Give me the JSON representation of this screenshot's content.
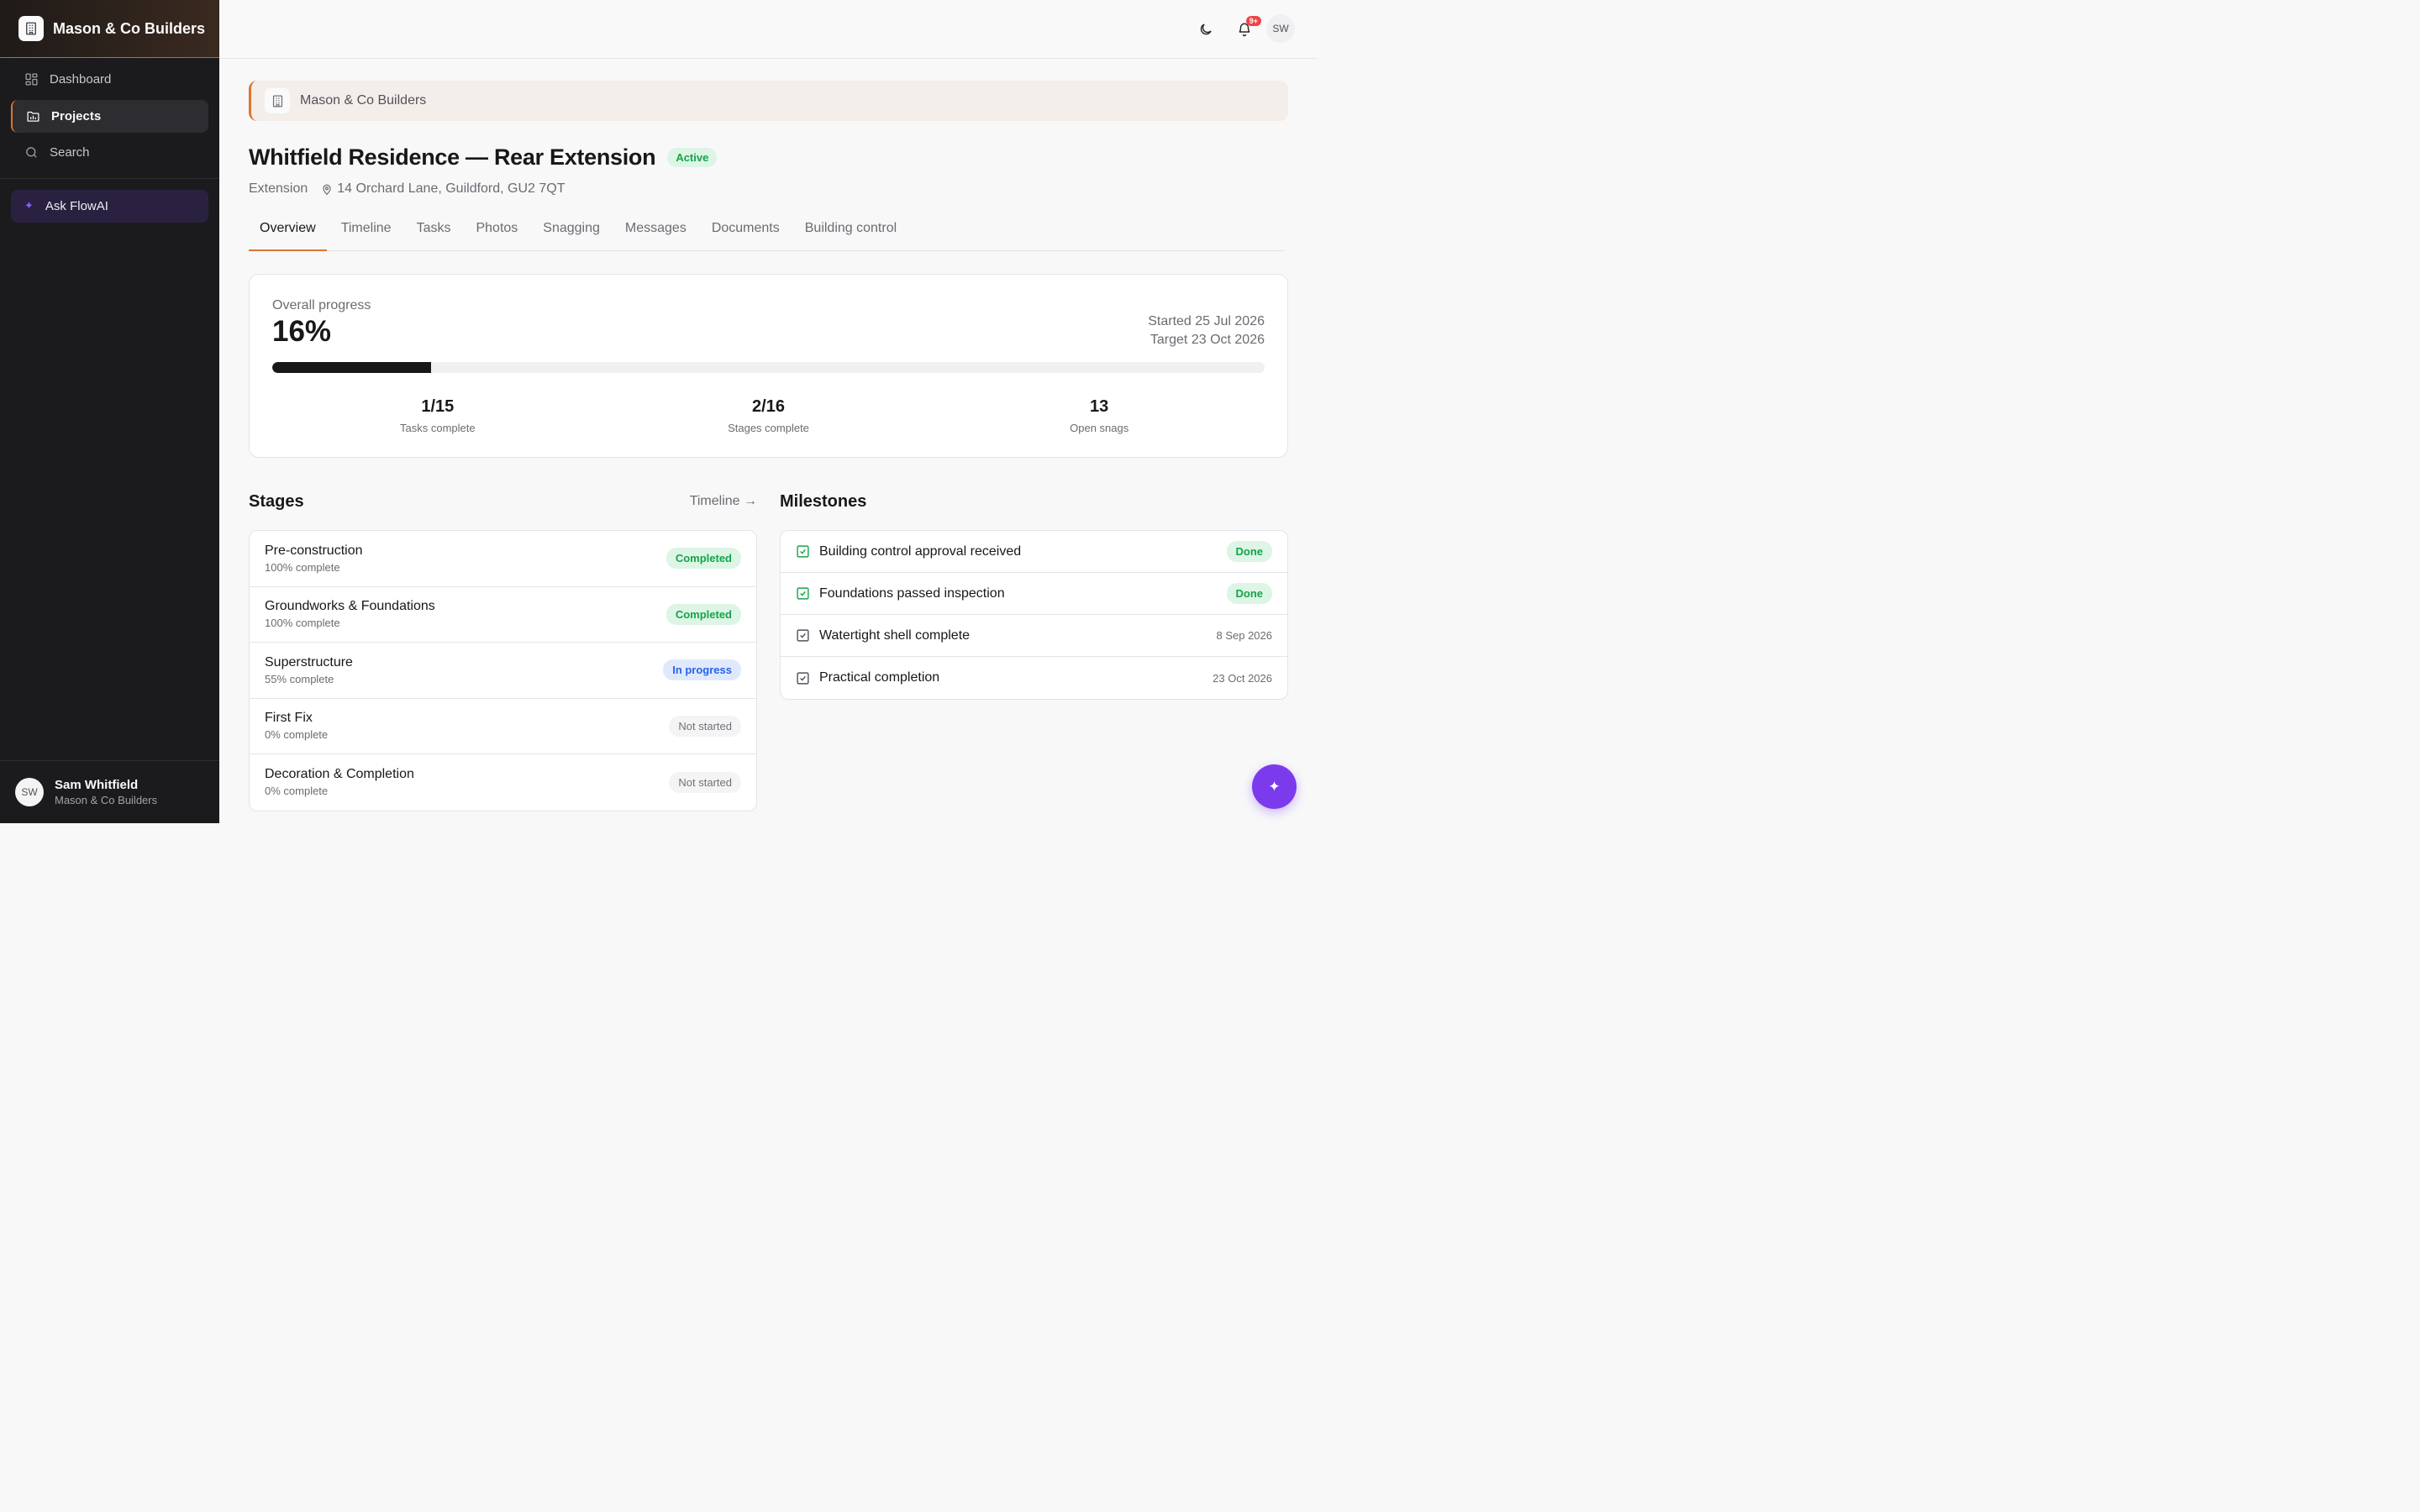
{
  "sidebar": {
    "brand": "Mason & Co Builders",
    "nav": [
      {
        "label": "Dashboard",
        "icon": "dashboard-icon"
      },
      {
        "label": "Projects",
        "icon": "folder-chart-icon",
        "active": true
      },
      {
        "label": "Search",
        "icon": "search-icon"
      }
    ],
    "ask": "Ask FlowAI",
    "user": {
      "initials": "SW",
      "name": "Sam Whitfield",
      "org": "Mason & Co Builders"
    }
  },
  "topbar": {
    "notif_badge": "9+",
    "avatar": "SW"
  },
  "org_banner": "Mason & Co Builders",
  "project": {
    "title": "Whitfield Residence — Rear Extension",
    "status": "Active",
    "type": "Extension",
    "address": "14 Orchard Lane, Guildford, GU2 7QT"
  },
  "tabs": [
    "Overview",
    "Timeline",
    "Tasks",
    "Photos",
    "Snagging",
    "Messages",
    "Documents",
    "Building control"
  ],
  "progress": {
    "label": "Overall progress",
    "value": "16%",
    "fraction": 0.16,
    "started": "Started 25 Jul 2026",
    "target": "Target 23 Oct 2026",
    "stats": [
      {
        "value": "1/15",
        "label": "Tasks complete"
      },
      {
        "value": "2/16",
        "label": "Stages complete"
      },
      {
        "value": "13",
        "label": "Open snags"
      }
    ]
  },
  "stages": {
    "title": "Stages",
    "link": "Timeline →",
    "items": [
      {
        "name": "Pre-construction",
        "pct": "100% complete",
        "status": "Completed",
        "kind": "done"
      },
      {
        "name": "Groundworks & Foundations",
        "pct": "100% complete",
        "status": "Completed",
        "kind": "done"
      },
      {
        "name": "Superstructure",
        "pct": "55% complete",
        "status": "In progress",
        "kind": "prog"
      },
      {
        "name": "First Fix",
        "pct": "0% complete",
        "status": "Not started",
        "kind": "not"
      },
      {
        "name": "Decoration & Completion",
        "pct": "0% complete",
        "status": "Not started",
        "kind": "not"
      }
    ]
  },
  "milestones": {
    "title": "Milestones",
    "items": [
      {
        "name": "Building control approval received",
        "right": "Done",
        "done": true
      },
      {
        "name": "Foundations passed inspection",
        "right": "Done",
        "done": true
      },
      {
        "name": "Watertight shell complete",
        "right": "8 Sep 2026",
        "done": false
      },
      {
        "name": "Practical completion",
        "right": "23 Oct 2026",
        "done": false
      }
    ]
  },
  "colors": {
    "accent": "#d9752f",
    "ai": "#7c3aed",
    "success": "#16a34a",
    "info": "#2563eb"
  }
}
